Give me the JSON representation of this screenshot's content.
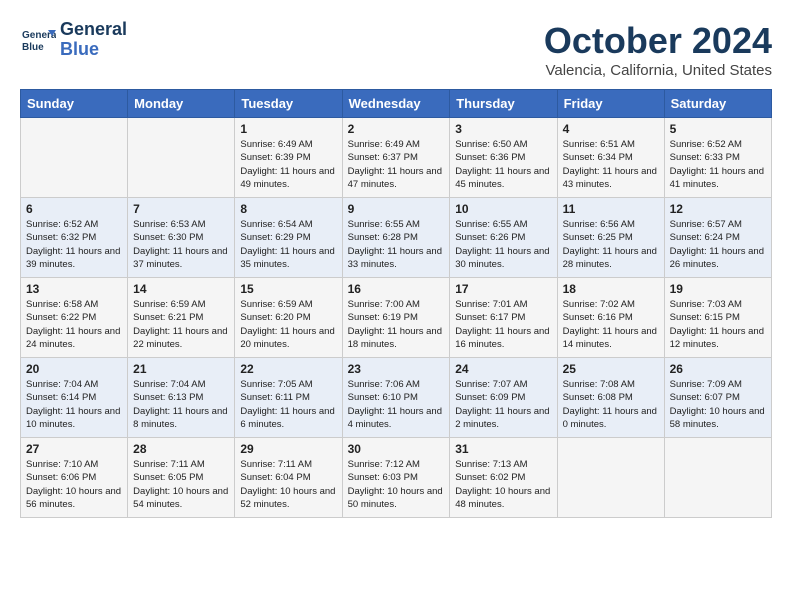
{
  "header": {
    "logo_line1": "General",
    "logo_line2": "Blue",
    "month": "October 2024",
    "location": "Valencia, California, United States"
  },
  "weekdays": [
    "Sunday",
    "Monday",
    "Tuesday",
    "Wednesday",
    "Thursday",
    "Friday",
    "Saturday"
  ],
  "weeks": [
    [
      {
        "day": "",
        "sunrise": "",
        "sunset": "",
        "daylight": ""
      },
      {
        "day": "",
        "sunrise": "",
        "sunset": "",
        "daylight": ""
      },
      {
        "day": "1",
        "sunrise": "Sunrise: 6:49 AM",
        "sunset": "Sunset: 6:39 PM",
        "daylight": "Daylight: 11 hours and 49 minutes."
      },
      {
        "day": "2",
        "sunrise": "Sunrise: 6:49 AM",
        "sunset": "Sunset: 6:37 PM",
        "daylight": "Daylight: 11 hours and 47 minutes."
      },
      {
        "day": "3",
        "sunrise": "Sunrise: 6:50 AM",
        "sunset": "Sunset: 6:36 PM",
        "daylight": "Daylight: 11 hours and 45 minutes."
      },
      {
        "day": "4",
        "sunrise": "Sunrise: 6:51 AM",
        "sunset": "Sunset: 6:34 PM",
        "daylight": "Daylight: 11 hours and 43 minutes."
      },
      {
        "day": "5",
        "sunrise": "Sunrise: 6:52 AM",
        "sunset": "Sunset: 6:33 PM",
        "daylight": "Daylight: 11 hours and 41 minutes."
      }
    ],
    [
      {
        "day": "6",
        "sunrise": "Sunrise: 6:52 AM",
        "sunset": "Sunset: 6:32 PM",
        "daylight": "Daylight: 11 hours and 39 minutes."
      },
      {
        "day": "7",
        "sunrise": "Sunrise: 6:53 AM",
        "sunset": "Sunset: 6:30 PM",
        "daylight": "Daylight: 11 hours and 37 minutes."
      },
      {
        "day": "8",
        "sunrise": "Sunrise: 6:54 AM",
        "sunset": "Sunset: 6:29 PM",
        "daylight": "Daylight: 11 hours and 35 minutes."
      },
      {
        "day": "9",
        "sunrise": "Sunrise: 6:55 AM",
        "sunset": "Sunset: 6:28 PM",
        "daylight": "Daylight: 11 hours and 33 minutes."
      },
      {
        "day": "10",
        "sunrise": "Sunrise: 6:55 AM",
        "sunset": "Sunset: 6:26 PM",
        "daylight": "Daylight: 11 hours and 30 minutes."
      },
      {
        "day": "11",
        "sunrise": "Sunrise: 6:56 AM",
        "sunset": "Sunset: 6:25 PM",
        "daylight": "Daylight: 11 hours and 28 minutes."
      },
      {
        "day": "12",
        "sunrise": "Sunrise: 6:57 AM",
        "sunset": "Sunset: 6:24 PM",
        "daylight": "Daylight: 11 hours and 26 minutes."
      }
    ],
    [
      {
        "day": "13",
        "sunrise": "Sunrise: 6:58 AM",
        "sunset": "Sunset: 6:22 PM",
        "daylight": "Daylight: 11 hours and 24 minutes."
      },
      {
        "day": "14",
        "sunrise": "Sunrise: 6:59 AM",
        "sunset": "Sunset: 6:21 PM",
        "daylight": "Daylight: 11 hours and 22 minutes."
      },
      {
        "day": "15",
        "sunrise": "Sunrise: 6:59 AM",
        "sunset": "Sunset: 6:20 PM",
        "daylight": "Daylight: 11 hours and 20 minutes."
      },
      {
        "day": "16",
        "sunrise": "Sunrise: 7:00 AM",
        "sunset": "Sunset: 6:19 PM",
        "daylight": "Daylight: 11 hours and 18 minutes."
      },
      {
        "day": "17",
        "sunrise": "Sunrise: 7:01 AM",
        "sunset": "Sunset: 6:17 PM",
        "daylight": "Daylight: 11 hours and 16 minutes."
      },
      {
        "day": "18",
        "sunrise": "Sunrise: 7:02 AM",
        "sunset": "Sunset: 6:16 PM",
        "daylight": "Daylight: 11 hours and 14 minutes."
      },
      {
        "day": "19",
        "sunrise": "Sunrise: 7:03 AM",
        "sunset": "Sunset: 6:15 PM",
        "daylight": "Daylight: 11 hours and 12 minutes."
      }
    ],
    [
      {
        "day": "20",
        "sunrise": "Sunrise: 7:04 AM",
        "sunset": "Sunset: 6:14 PM",
        "daylight": "Daylight: 11 hours and 10 minutes."
      },
      {
        "day": "21",
        "sunrise": "Sunrise: 7:04 AM",
        "sunset": "Sunset: 6:13 PM",
        "daylight": "Daylight: 11 hours and 8 minutes."
      },
      {
        "day": "22",
        "sunrise": "Sunrise: 7:05 AM",
        "sunset": "Sunset: 6:11 PM",
        "daylight": "Daylight: 11 hours and 6 minutes."
      },
      {
        "day": "23",
        "sunrise": "Sunrise: 7:06 AM",
        "sunset": "Sunset: 6:10 PM",
        "daylight": "Daylight: 11 hours and 4 minutes."
      },
      {
        "day": "24",
        "sunrise": "Sunrise: 7:07 AM",
        "sunset": "Sunset: 6:09 PM",
        "daylight": "Daylight: 11 hours and 2 minutes."
      },
      {
        "day": "25",
        "sunrise": "Sunrise: 7:08 AM",
        "sunset": "Sunset: 6:08 PM",
        "daylight": "Daylight: 11 hours and 0 minutes."
      },
      {
        "day": "26",
        "sunrise": "Sunrise: 7:09 AM",
        "sunset": "Sunset: 6:07 PM",
        "daylight": "Daylight: 10 hours and 58 minutes."
      }
    ],
    [
      {
        "day": "27",
        "sunrise": "Sunrise: 7:10 AM",
        "sunset": "Sunset: 6:06 PM",
        "daylight": "Daylight: 10 hours and 56 minutes."
      },
      {
        "day": "28",
        "sunrise": "Sunrise: 7:11 AM",
        "sunset": "Sunset: 6:05 PM",
        "daylight": "Daylight: 10 hours and 54 minutes."
      },
      {
        "day": "29",
        "sunrise": "Sunrise: 7:11 AM",
        "sunset": "Sunset: 6:04 PM",
        "daylight": "Daylight: 10 hours and 52 minutes."
      },
      {
        "day": "30",
        "sunrise": "Sunrise: 7:12 AM",
        "sunset": "Sunset: 6:03 PM",
        "daylight": "Daylight: 10 hours and 50 minutes."
      },
      {
        "day": "31",
        "sunrise": "Sunrise: 7:13 AM",
        "sunset": "Sunset: 6:02 PM",
        "daylight": "Daylight: 10 hours and 48 minutes."
      },
      {
        "day": "",
        "sunrise": "",
        "sunset": "",
        "daylight": ""
      },
      {
        "day": "",
        "sunrise": "",
        "sunset": "",
        "daylight": ""
      }
    ]
  ]
}
